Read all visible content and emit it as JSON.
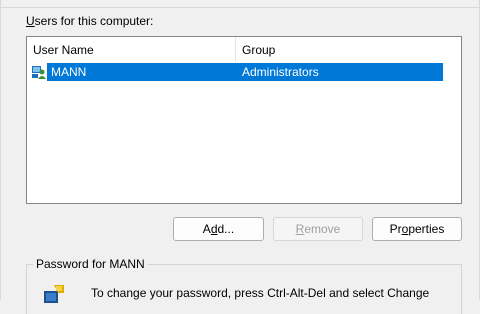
{
  "users_label": "Users for this computer:",
  "users_label_access_key": "U",
  "users_label_rest": "sers for this computer:",
  "list": {
    "columns": [
      "User Name",
      "Group"
    ],
    "rows": [
      {
        "user_name": "MANN",
        "group": "Administrators",
        "selected": true,
        "icon": "user-group-icon"
      }
    ]
  },
  "buttons": {
    "add_pre": "A",
    "add_key": "d",
    "add_post": "d...",
    "remove_key": "R",
    "remove_post": "emove",
    "props_pre": "Pr",
    "props_key": "o",
    "props_post": "perties"
  },
  "password_group": {
    "title": "Password for MANN",
    "text": "To change your password, press Ctrl-Alt-Del and select Change",
    "icon": "keyboard-key-icon"
  },
  "colors": {
    "selection": "#0078d7",
    "background": "#f0f0f0"
  }
}
